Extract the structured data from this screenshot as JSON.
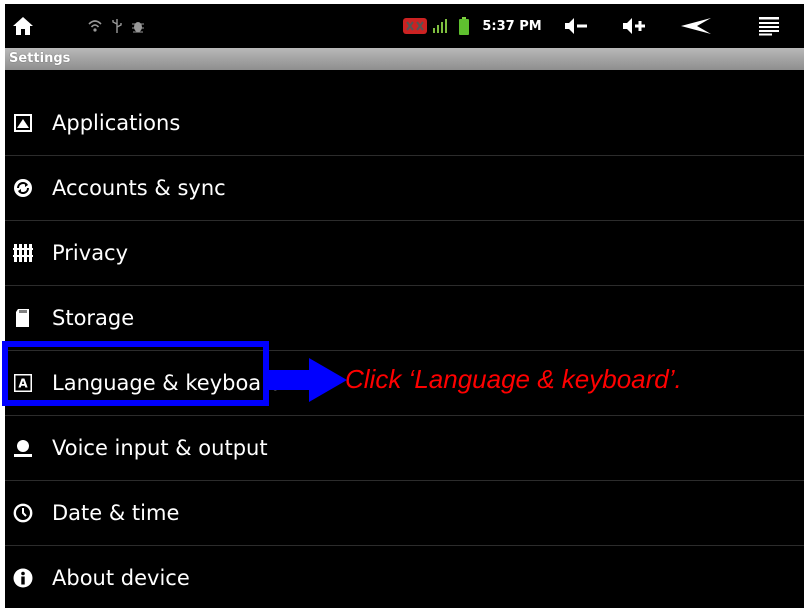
{
  "status_bar": {
    "time": "5:37 PM",
    "icons": [
      "home-icon",
      "wifi-icon",
      "usb-icon",
      "debug-icon",
      "notification-icon",
      "signal-icon",
      "battery-icon",
      "volume-down-icon",
      "volume-up-icon",
      "back-icon",
      "menu-icon"
    ]
  },
  "title_bar": {
    "title": "Settings"
  },
  "settings_items": [
    {
      "label": "Applications",
      "icon": "applications-icon"
    },
    {
      "label": "Accounts & sync",
      "icon": "sync-icon"
    },
    {
      "label": "Privacy",
      "icon": "privacy-icon"
    },
    {
      "label": "Storage",
      "icon": "storage-icon"
    },
    {
      "label": "Language & keyboard",
      "icon": "language-icon"
    },
    {
      "label": "Voice input & output",
      "icon": "voice-icon"
    },
    {
      "label": "Date & time",
      "icon": "clock-icon"
    },
    {
      "label": "About device",
      "icon": "info-icon"
    }
  ],
  "annotation": {
    "text": "Click ‘Language & keyboard’.",
    "highlight_color": "#0000ff",
    "text_color": "#ff0000"
  }
}
